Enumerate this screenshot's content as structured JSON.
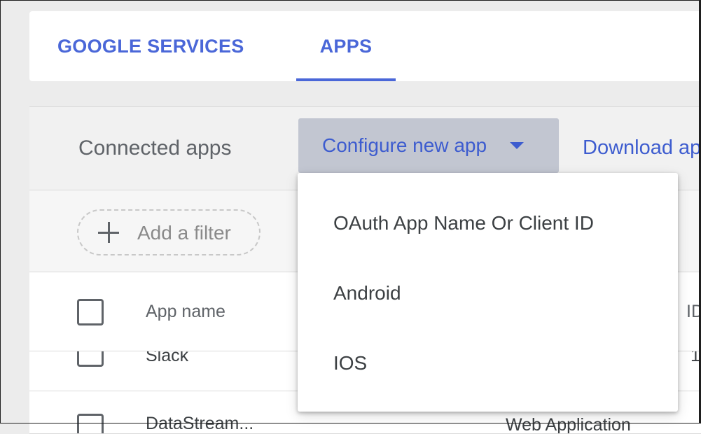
{
  "tabs": [
    {
      "label": "GOOGLE SERVICES",
      "active": false
    },
    {
      "label": "APPS",
      "active": true
    }
  ],
  "toolbar": {
    "title": "Connected apps",
    "configure_label": "Configure new app",
    "download_label": "Download ap"
  },
  "filter": {
    "label": "Add a filter"
  },
  "table": {
    "columns": [
      "App name",
      "ID"
    ],
    "rows": [
      {
        "name": "Slack",
        "type": "",
        "id": "1"
      },
      {
        "name": "DataStream...",
        "type": "Web Application",
        "id": ""
      }
    ]
  },
  "dropdown": {
    "items": [
      "OAuth App Name Or Client ID",
      "Android",
      "IOS"
    ]
  },
  "colors": {
    "accent": "#4a67d8",
    "button_bg": "#c2c6d1",
    "page_bg": "#ececec"
  }
}
